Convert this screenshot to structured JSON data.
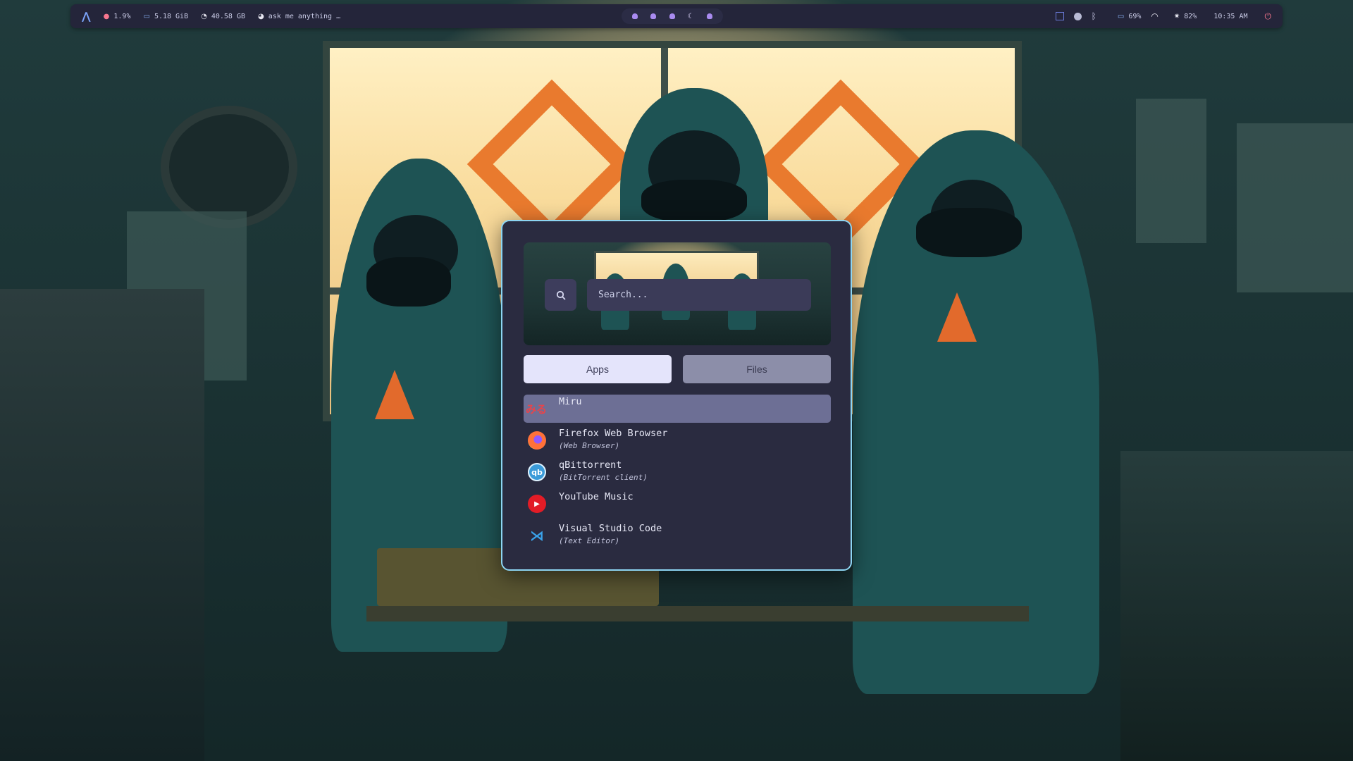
{
  "topbar": {
    "cpu": "1.9%",
    "memory": "5.18 GiB",
    "disk": "40.58 GB",
    "assistant": "ask me anything …",
    "battery": "69%",
    "brightness": "82%",
    "time": "10:35 AM"
  },
  "launcher": {
    "search": {
      "placeholder": "Search..."
    },
    "tabs": {
      "apps": "Apps",
      "files": "Files"
    },
    "apps": [
      {
        "name": "Miru",
        "desc": "",
        "icon": "miru-icon",
        "icon_text": "みる"
      },
      {
        "name": "Firefox Web Browser",
        "desc": "(Web Browser)",
        "icon": "firefox-icon"
      },
      {
        "name": "qBittorrent",
        "desc": "(BitTorrent client)",
        "icon": "qbittorrent-icon",
        "icon_text": "qb"
      },
      {
        "name": "YouTube Music",
        "desc": "",
        "icon": "youtube-music-icon"
      },
      {
        "name": "Visual Studio Code",
        "desc": "(Text Editor)",
        "icon": "vscode-icon"
      }
    ]
  },
  "colors": {
    "bar_bg": "#24253a",
    "launcher_bg": "#2a2b40",
    "launcher_border": "#8dd5f2",
    "selected_row": "#6d6f95",
    "workspace_dot": "#a98bf0"
  }
}
